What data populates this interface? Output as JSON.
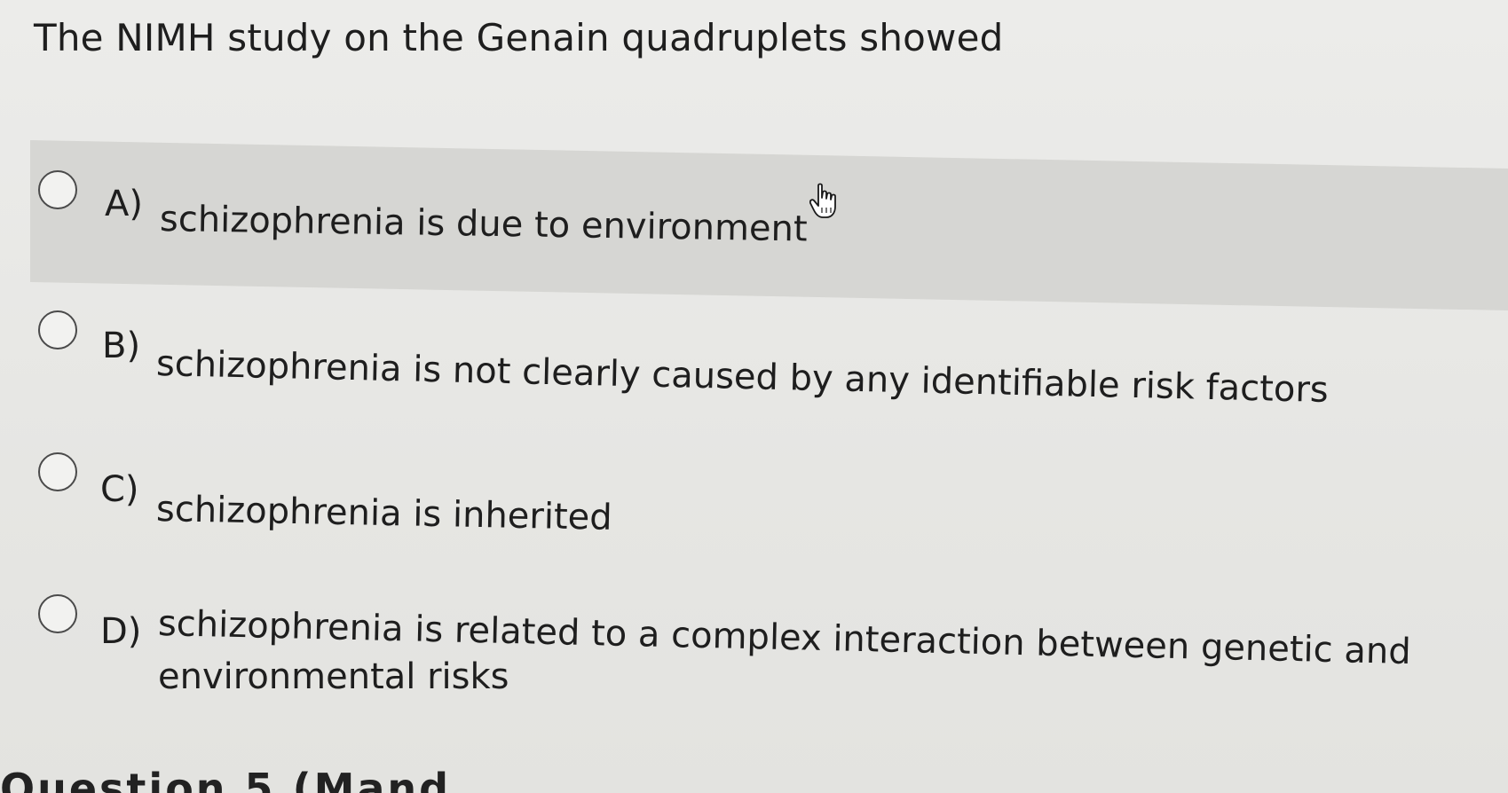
{
  "question": {
    "text": "The NIMH study on the Genain quadruplets showed"
  },
  "options": [
    {
      "letter": "A)",
      "text": "schizophrenia is due to environment",
      "hovered": true
    },
    {
      "letter": "B)",
      "text": "schizophrenia is not clearly caused by any identifiable risk factors",
      "hovered": false
    },
    {
      "letter": "C)",
      "text": "schizophrenia is inherited",
      "hovered": false
    },
    {
      "letter": "D)",
      "text_line1": "schizophrenia is related to a complex interaction between genetic and",
      "text_line2": "environmental risks",
      "hovered": false
    }
  ],
  "footer": {
    "next_question_partial": "Question 5 (Mand"
  },
  "colors": {
    "background": "#e9e9e6",
    "hover_band": "#d6d6d3",
    "text": "#1e1e1e"
  },
  "icons": {
    "cursor": "hand-pointer-icon"
  }
}
